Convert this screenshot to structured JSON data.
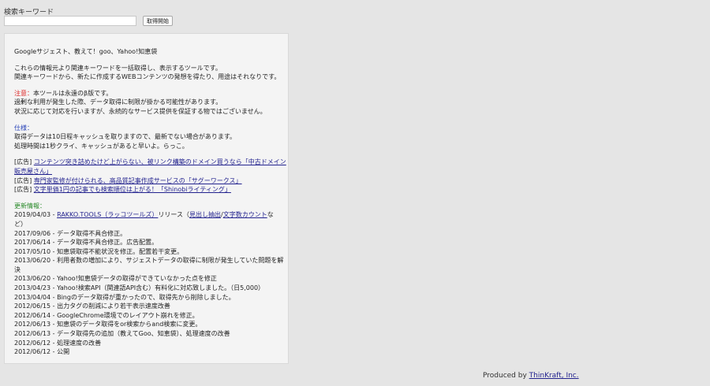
{
  "search": {
    "label": "検索キーワード",
    "value": "",
    "button_label": "取得開始"
  },
  "intro": {
    "title": "Googleサジェスト、教えて！goo、Yahoo!知恵袋",
    "desc1": "これらの情報元より関連キーワードを一括取得し、表示するツールです。",
    "desc2": "関連キーワードから、新たに作成するWEBコンテンツの発想を得たり、用途はそれなりです。"
  },
  "notice": {
    "label": "注意：",
    "line1": "本ツールは永遠のβ版です。",
    "line2": "過剰な利用が発生した際、データ取得に制限が掛かる可能性があります。",
    "line3": "状況に応じて対応を行いますが、永続的なサービス提供を保証する物ではございません。"
  },
  "spec": {
    "label": "仕様：",
    "line1": "取得データは10日程キャッシュを取りますので、最新でない場合があります。",
    "line2": "処理時間は1秒クライ、キャッシュがあると早いよ。らっこ。"
  },
  "ads": [
    {
      "tag": "[広告]",
      "text": "コンテンツ突き詰めたけど上がらない、被リンク構築のドメイン買うなら「中古ドメイン",
      "text2": "販売屋さん」"
    },
    {
      "tag": "[広告]",
      "text": "専門家監修が付けられる、高品質記事作成サービスの「サグーワークス」"
    },
    {
      "tag": "[広告]",
      "text": "文字単価1円の記事でも検索順位は上がる！「Shinobiライティング」"
    }
  ],
  "updates": {
    "title": "更新情報：",
    "first": {
      "date": "2019/04/03 - ",
      "link1": "RAKKO.TOOLS（ラッコツールズ）",
      "mid": "リリース（",
      "link2": "見出し抽出",
      "sep": "/",
      "link3": "文字数カウント",
      "end1": "な",
      "end2": "ど）"
    },
    "items": [
      "2017/09/06 - データ取得不具合修正。",
      "2017/06/14 - データ取得不具合修正。広告配置。",
      "2017/05/10 - 知恵袋取得不能状況を修正。配置若干変更。",
      "2013/06/20 - 利用者数の増加により、サジェストデータの取得に制限が発生していた問題を解",
      "決",
      "2013/06/20 - Yahoo!知恵袋データの取得ができていなかった点を修正",
      "2013/04/23 - Yahoo!検索API（関連語API含む）有料化に対応致しました。（日5,000）",
      "2013/04/04 - Bingのデータ取得が重かったので、取得先から削除しました。",
      "2012/06/15 - 出力タグの削減により若干表示速度改善",
      "2012/06/14 - GoogleChrome環境でのレイアウト崩れを修正。",
      "2012/06/13 - 知恵袋のデータ取得をor検索からand検索に変更。",
      "2012/06/13 - データ取得先の追加（教えてGoo、知恵袋）、処理速度の改善",
      "2012/06/12 - 処理速度の改善",
      "2012/06/12 - 公開"
    ]
  },
  "footer": {
    "prefix": "Produced by ",
    "link": "ThinKraft, Inc."
  },
  "colors": {
    "notice": "#dd2222",
    "spec": "#2a45b8",
    "updates_title": "#2a8a2a",
    "link": "#23238f"
  }
}
